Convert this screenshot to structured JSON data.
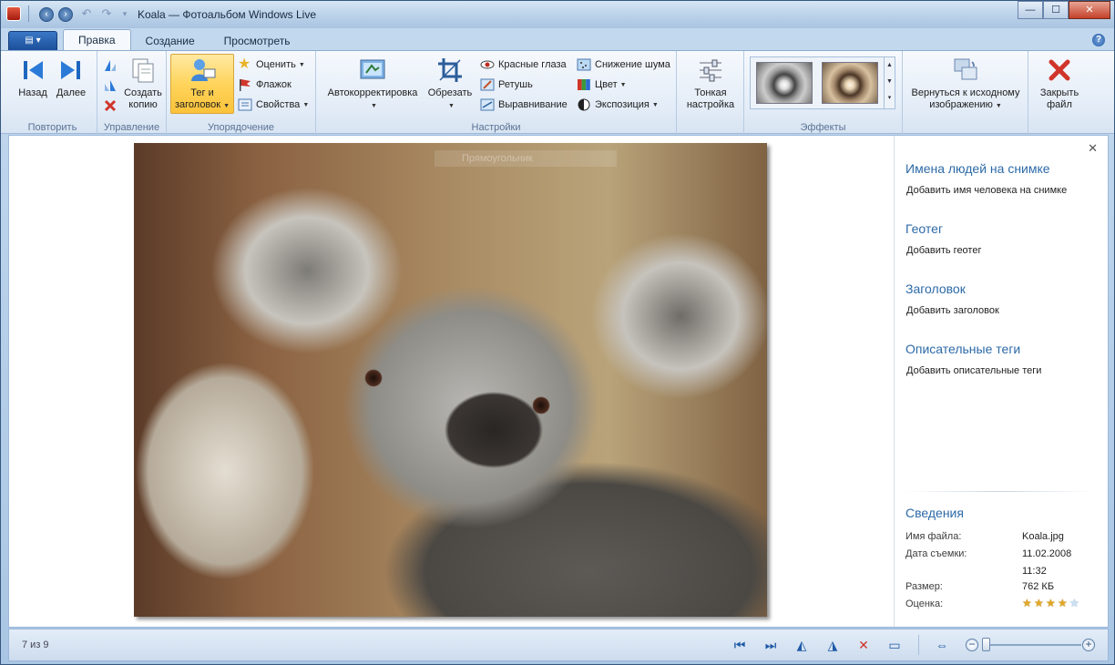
{
  "window": {
    "title": "Koala — Фотоальбом Windows Live",
    "minimize": "—",
    "maximize": "☐",
    "close": "✕"
  },
  "tabs": {
    "file_menu": "▤ ▾",
    "items": [
      "Правка",
      "Создание",
      "Просмотреть"
    ],
    "active": "Правка"
  },
  "ribbon": {
    "groups": {
      "repeat": {
        "label": "Повторить",
        "back": "Назад",
        "next": "Далее"
      },
      "manage": {
        "label": "Управление",
        "copy_line1": "Создать",
        "copy_line2": "копию"
      },
      "organize": {
        "label": "Упорядочение",
        "tag_line1": "Тег и",
        "tag_line2": "заголовок",
        "rate": "Оценить",
        "flag": "Флажок",
        "properties": "Свойства"
      },
      "adjust": {
        "label": "Настройки",
        "autocorrect": "Автокорректировка",
        "crop": "Обрезать",
        "red_eye": "Красные глаза",
        "retouch": "Ретушь",
        "straighten": "Выравнивание",
        "noise": "Снижение шума",
        "color": "Цвет",
        "exposure": "Экспозиция",
        "fine_line1": "Тонкая",
        "fine_line2": "настройка"
      },
      "effects": {
        "label": "Эффекты"
      },
      "revert": {
        "line1": "Вернуться к исходному",
        "line2": "изображению"
      },
      "close_file": {
        "line1": "Закрыть",
        "line2": "файл"
      }
    }
  },
  "photo": {
    "overlay_label": "Прямоугольник"
  },
  "side_panel": {
    "sections": [
      {
        "heading": "Имена людей на снимке",
        "link": "Добавить имя человека на снимке"
      },
      {
        "heading": "Геотег",
        "link": "Добавить геотег"
      },
      {
        "heading": "Заголовок",
        "link": "Добавить заголовок"
      },
      {
        "heading": "Описательные теги",
        "link": "Добавить описательные теги"
      }
    ],
    "info": {
      "heading": "Сведения",
      "filename_label": "Имя файла:",
      "filename": "Koala.jpg",
      "date_label": "Дата съемки:",
      "date": "11.02.2008",
      "time": "11:32",
      "size_label": "Размер:",
      "size": "762 КБ",
      "rating_label": "Оценка:",
      "rating": 4,
      "rating_max": 5
    }
  },
  "status": {
    "position": "7 из 9",
    "zoom_fraction": 0.05
  },
  "colors": {
    "accent": "#2d6aa8",
    "selected": "#ffd45c"
  }
}
